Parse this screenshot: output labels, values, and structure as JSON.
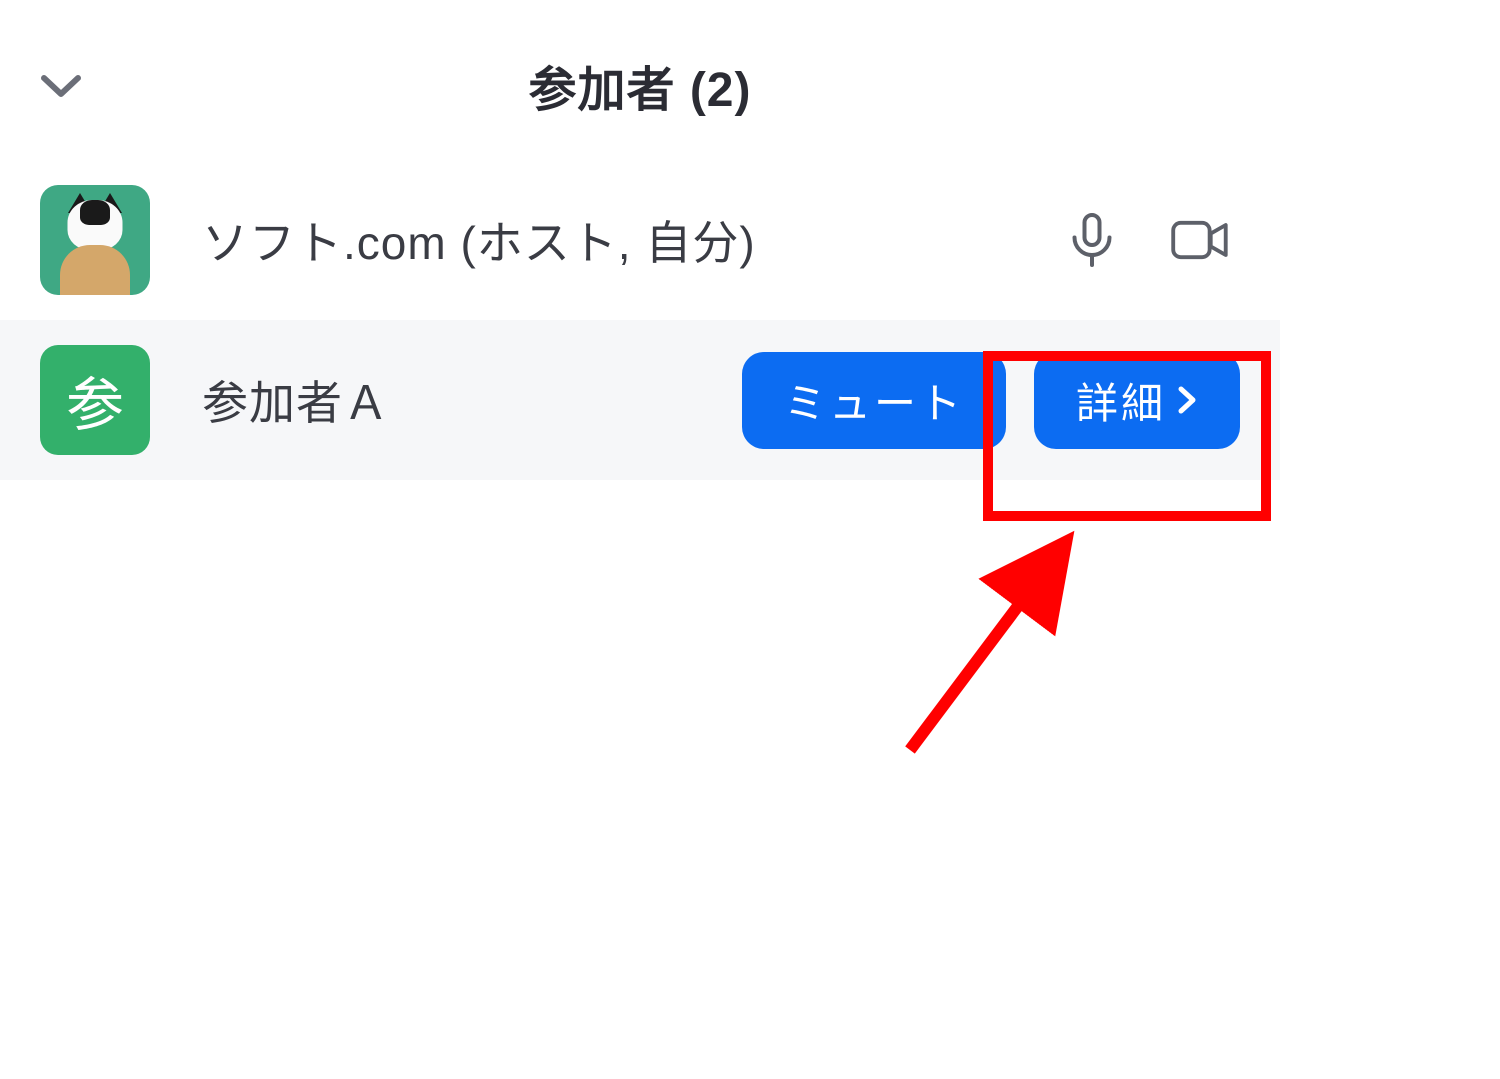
{
  "header": {
    "title": "参加者 (2)"
  },
  "participants": [
    {
      "name": "ソフト.com (ホスト, 自分)",
      "avatar_type": "image"
    },
    {
      "name": "参加者Ａ",
      "avatar_type": "letter",
      "avatar_letter": "参"
    }
  ],
  "buttons": {
    "mute": "ミュート",
    "more": "詳細"
  },
  "colors": {
    "primary_button": "#0c6cf2",
    "avatar_green": "#33b06b",
    "highlight_red": "#ff0000"
  }
}
